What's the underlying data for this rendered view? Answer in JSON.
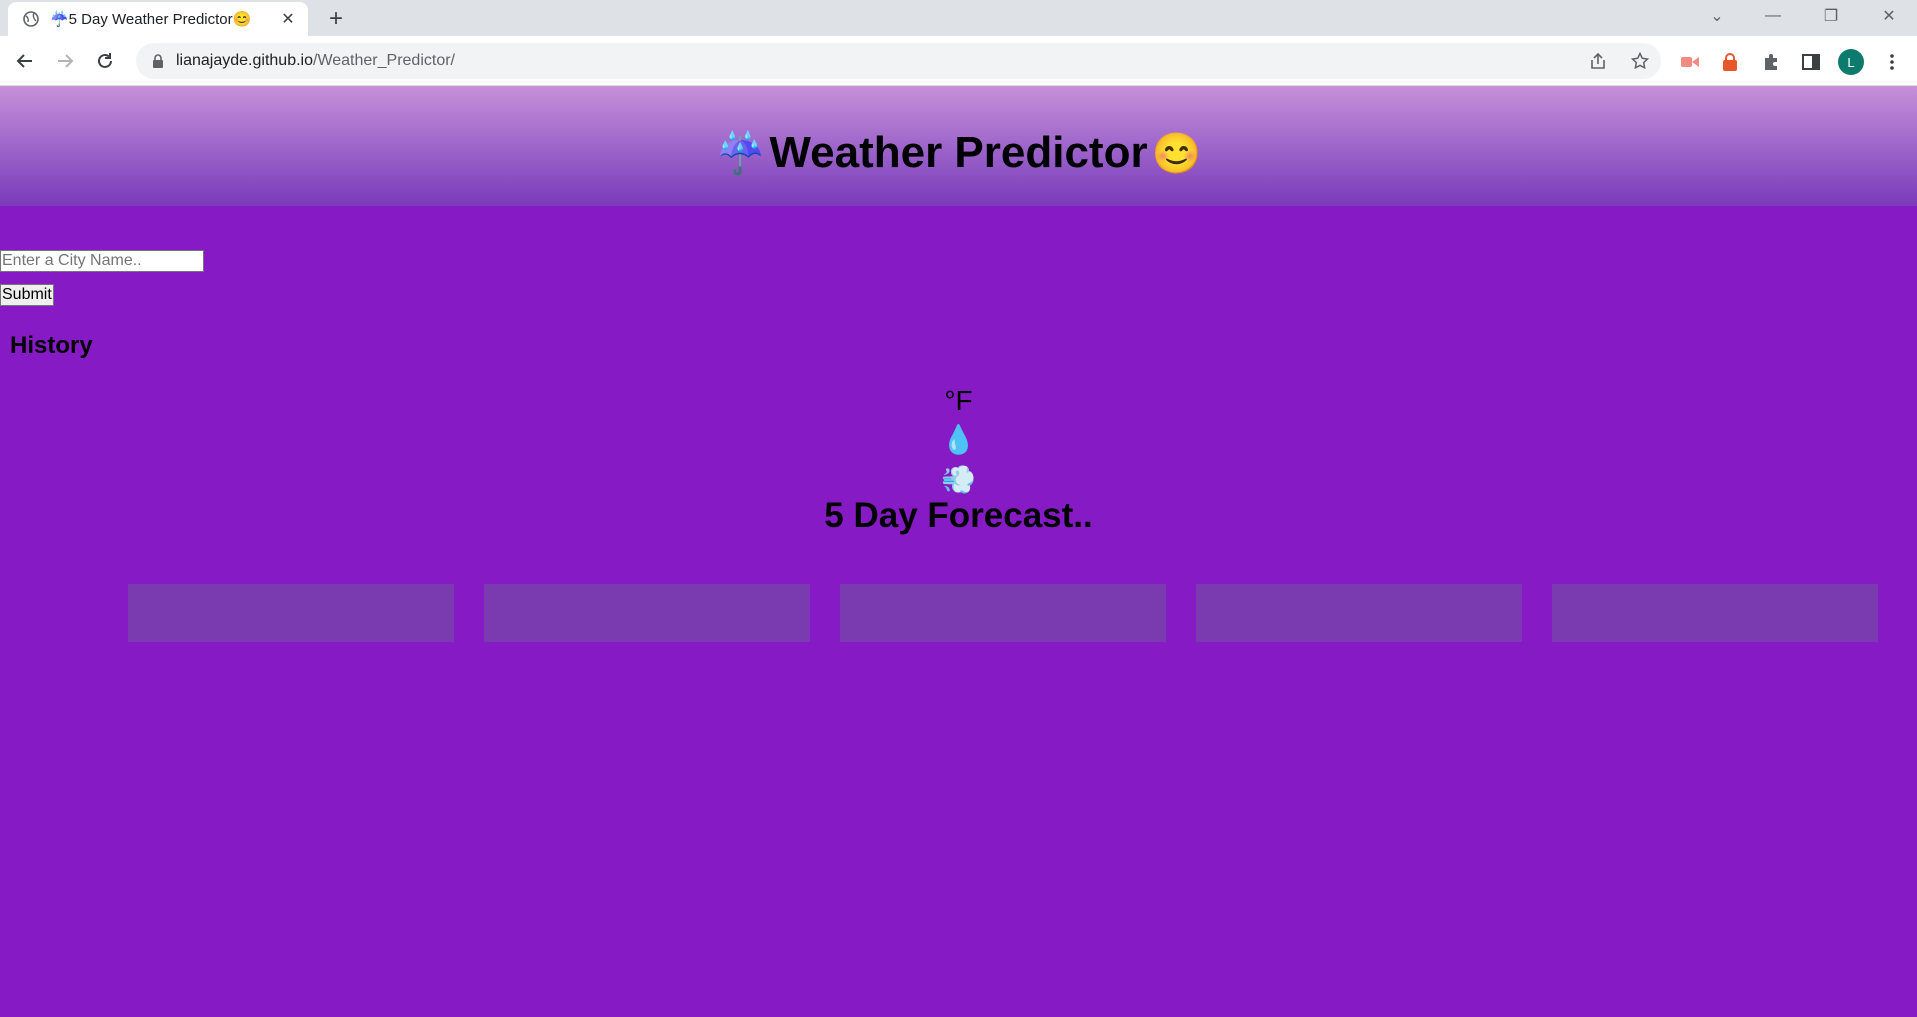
{
  "browser": {
    "tab_title": "☔5 Day Weather Predictor😊",
    "url_host": "lianajayde.github.io",
    "url_path": "/Weather_Predictor/",
    "profile_initial": "L"
  },
  "header": {
    "left_emoji": "☔",
    "title": "Weather Predictor",
    "right_emoji": "😊"
  },
  "search": {
    "placeholder": "Enter a City Name..",
    "submit_label": "Submit"
  },
  "history": {
    "heading": "History"
  },
  "current": {
    "temp_unit": "°F",
    "humidity_icon": "💧",
    "wind_icon": "💨"
  },
  "forecast": {
    "title": "5 Day Forecast..",
    "cards": [
      "",
      "",
      "",
      "",
      ""
    ]
  },
  "colors": {
    "page_bg": "#861ac4",
    "card_bg": "#7b3bb0"
  }
}
